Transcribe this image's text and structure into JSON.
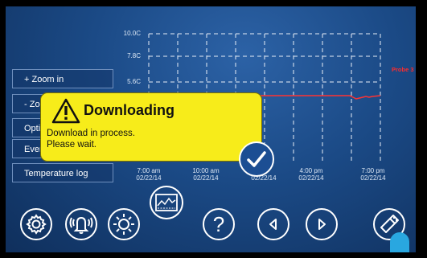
{
  "menu": {
    "zoom_in": "+ Zoom in",
    "zoom_out": "- Zo",
    "options": "Opti",
    "events": "Ever",
    "temperature_log": "Temperature log"
  },
  "chart_data": {
    "type": "line",
    "y_ticks": [
      "10.0C",
      "7.8C",
      "5.6C"
    ],
    "x_ticks": [
      {
        "time": "7:00 am",
        "date": "02/22/14"
      },
      {
        "time": "10:00 am",
        "date": "02/22/14"
      },
      {
        "time": "",
        "date": "02/22/14"
      },
      {
        "time": "4:00 pm",
        "date": "02/22/14"
      },
      {
        "time": "7:00 pm",
        "date": "02/22/14"
      }
    ],
    "grid": true,
    "series": [
      {
        "name": "Probe 3",
        "color": "#ff2b2b",
        "note_values": "approximately flat at ~4.8C across the range with a small dip near 4:00 pm"
      }
    ]
  },
  "popup": {
    "title": "Downloading",
    "line1": "Download in process.",
    "line2": "Please wait.",
    "background": "#f7ec1a"
  },
  "icons": [
    "gear-icon",
    "alarm-bell-icon",
    "brightness-icon",
    "graph-view-icon",
    "help-icon",
    "previous-arrow-icon",
    "next-arrow-icon",
    "usb-download-icon",
    "confirm-check-icon"
  ],
  "help_label": "?"
}
